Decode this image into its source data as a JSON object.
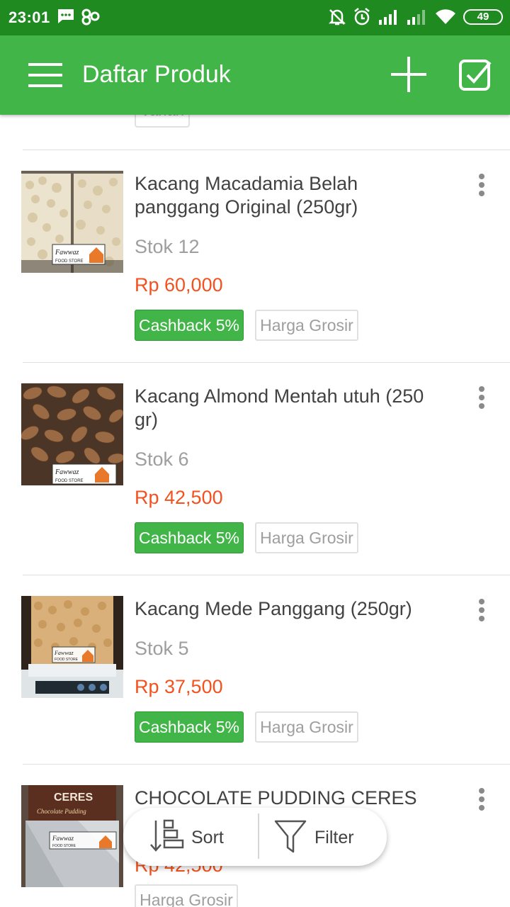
{
  "status_bar": {
    "time": "23:01",
    "battery": "49",
    "icons": [
      "message-icon",
      "link-icon",
      "mute-icon",
      "alarm-icon",
      "signal-icon",
      "signal-icon",
      "wifi-icon",
      "battery-icon"
    ]
  },
  "app_bar": {
    "title": "Daftar Produk",
    "icons": [
      "menu-icon",
      "plus-icon",
      "checkbox-icon"
    ]
  },
  "previous_item": {
    "tag": "Varian"
  },
  "products": [
    {
      "name": "Kacang Macadamia Belah panggang Original (250gr)",
      "stock": "Stok 12",
      "price": "Rp 60,000",
      "cashback": "Cashback 5%",
      "grosir": "Harga Grosir",
      "watermark": "Fawwaz FOOD STORE"
    },
    {
      "name": "Kacang Almond Mentah utuh (250 gr)",
      "stock": "Stok 6",
      "price": "Rp 42,500",
      "cashback": "Cashback 5%",
      "grosir": "Harga Grosir",
      "watermark": "Fawwaz FOOD STORE"
    },
    {
      "name": "Kacang Mede Panggang (250gr)",
      "stock": "Stok 5",
      "price": "Rp 37,500",
      "cashback": "Cashback 5%",
      "grosir": "Harga Grosir",
      "watermark": "Fawwaz FOOD STORE"
    },
    {
      "name": "CHOCOLATE PUDDING CERES",
      "price": "Rp 42,500",
      "grosir": "Harga Grosir",
      "package_text": "CERES",
      "package_sub": "Chocolate Pudding",
      "watermark": "Fawwaz FOOD STORE"
    }
  ],
  "bottom_actions": {
    "sort_label": "Sort",
    "filter_label": "Filter"
  },
  "colors": {
    "status_bar": "#1f8a1f",
    "app_bar": "#42b549",
    "price": "#f4511e",
    "cashback_bg": "#42b549"
  }
}
